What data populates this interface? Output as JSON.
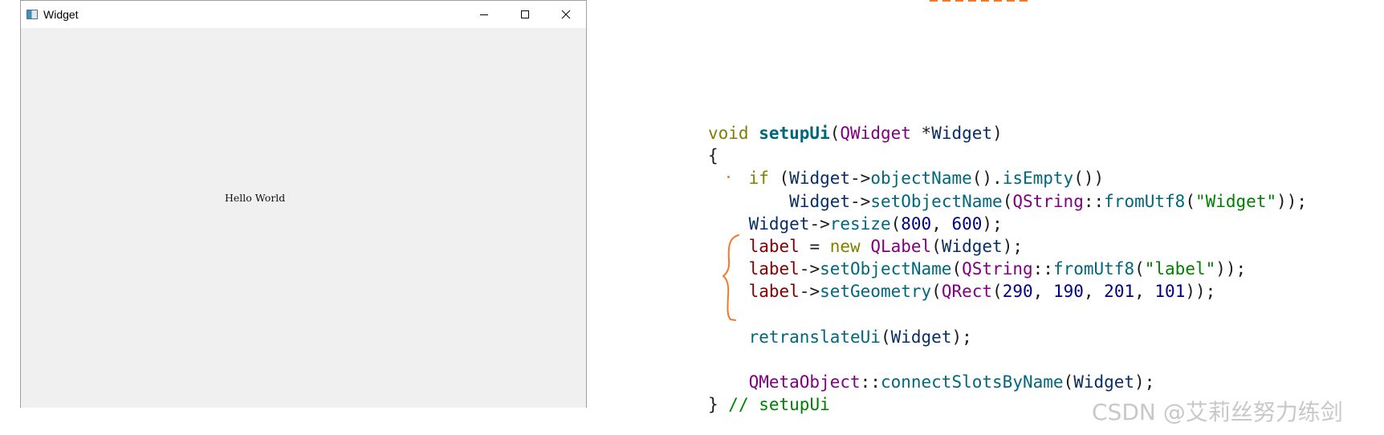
{
  "window": {
    "title": "Widget",
    "controls": [
      "minimize",
      "maximize",
      "close"
    ]
  },
  "client": {
    "label_text": "Hello World"
  },
  "code": {
    "lines": [
      [
        [
          "kw",
          "void "
        ],
        [
          "fn-bold",
          "setupUi"
        ],
        [
          "",
          "("
        ],
        [
          "cls",
          "QWidget"
        ],
        [
          "",
          " *"
        ],
        [
          "var",
          "Widget"
        ],
        [
          "",
          ")"
        ]
      ],
      [
        [
          "",
          "{"
        ]
      ],
      [
        [
          "",
          "    "
        ],
        [
          "kw",
          "if"
        ],
        [
          "",
          " ("
        ],
        [
          "var",
          "Widget"
        ],
        [
          "",
          "->"
        ],
        [
          "meth",
          "objectName"
        ],
        [
          "",
          "()."
        ],
        [
          "meth",
          "isEmpty"
        ],
        [
          "",
          "())"
        ]
      ],
      [
        [
          "",
          "        "
        ],
        [
          "var",
          "Widget"
        ],
        [
          "",
          "->"
        ],
        [
          "meth",
          "setObjectName"
        ],
        [
          "",
          "("
        ],
        [
          "cls",
          "QString"
        ],
        [
          "",
          "::"
        ],
        [
          "meth",
          "fromUtf8"
        ],
        [
          "",
          "("
        ],
        [
          "str",
          "\"Widget\""
        ],
        [
          "",
          "));"
        ]
      ],
      [
        [
          "",
          "    "
        ],
        [
          "var",
          "Widget"
        ],
        [
          "",
          "->"
        ],
        [
          "meth",
          "resize"
        ],
        [
          "",
          "("
        ],
        [
          "num",
          "800"
        ],
        [
          "",
          ", "
        ],
        [
          "num",
          "600"
        ],
        [
          "",
          ");"
        ]
      ],
      [
        [
          "",
          "    "
        ],
        [
          "mem",
          "label"
        ],
        [
          "",
          " = "
        ],
        [
          "kw",
          "new "
        ],
        [
          "cls",
          "QLabel"
        ],
        [
          "",
          "("
        ],
        [
          "var",
          "Widget"
        ],
        [
          "",
          ");"
        ]
      ],
      [
        [
          "",
          "    "
        ],
        [
          "mem",
          "label"
        ],
        [
          "",
          "->"
        ],
        [
          "meth",
          "setObjectName"
        ],
        [
          "",
          "("
        ],
        [
          "cls",
          "QString"
        ],
        [
          "",
          "::"
        ],
        [
          "meth",
          "fromUtf8"
        ],
        [
          "",
          "("
        ],
        [
          "str",
          "\"label\""
        ],
        [
          "",
          "));"
        ]
      ],
      [
        [
          "",
          "    "
        ],
        [
          "mem",
          "label"
        ],
        [
          "",
          "->"
        ],
        [
          "meth",
          "setGeometry"
        ],
        [
          "",
          "("
        ],
        [
          "cls",
          "QRect"
        ],
        [
          "",
          "("
        ],
        [
          "num",
          "290"
        ],
        [
          "",
          ", "
        ],
        [
          "num",
          "190"
        ],
        [
          "",
          ", "
        ],
        [
          "num",
          "201"
        ],
        [
          "",
          ", "
        ],
        [
          "num",
          "101"
        ],
        [
          "",
          "));"
        ]
      ],
      [
        [
          "",
          ""
        ]
      ],
      [
        [
          "",
          "    "
        ],
        [
          "meth",
          "retranslateUi"
        ],
        [
          "",
          "("
        ],
        [
          "var",
          "Widget"
        ],
        [
          "",
          ");"
        ]
      ],
      [
        [
          "",
          ""
        ]
      ],
      [
        [
          "",
          "    "
        ],
        [
          "cls",
          "QMetaObject"
        ],
        [
          "",
          "::"
        ],
        [
          "meth",
          "connectSlotsByName"
        ],
        [
          "",
          "("
        ],
        [
          "var",
          "Widget"
        ],
        [
          "",
          ");"
        ]
      ],
      [
        [
          "",
          "} "
        ],
        [
          "cmt",
          "// setupUi"
        ]
      ]
    ]
  },
  "watermark": "CSDN @艾莉丝努力练剑",
  "colors": {
    "annotation": "#f07a2a",
    "window_bg": "#f0f0f0"
  }
}
